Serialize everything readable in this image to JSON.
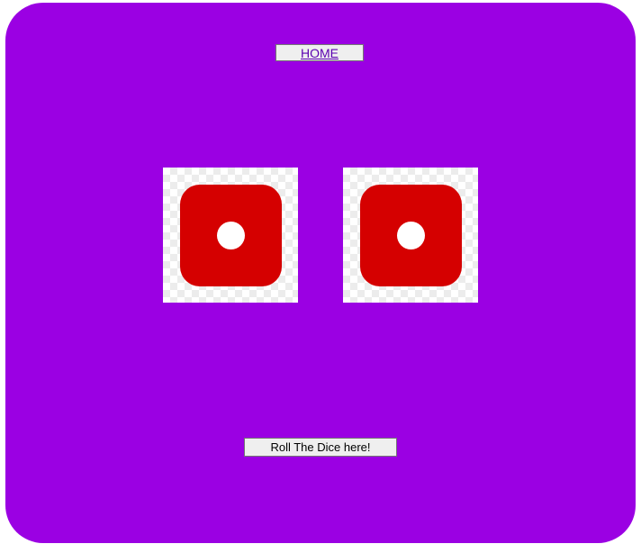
{
  "nav": {
    "home_label": "HOME"
  },
  "dice": [
    {
      "value": 1,
      "face_color": "#d50000"
    },
    {
      "value": 1,
      "face_color": "#d50000"
    }
  ],
  "actions": {
    "roll_label": "Roll The Dice here!"
  },
  "theme": {
    "panel_background": "#9b00e3"
  }
}
